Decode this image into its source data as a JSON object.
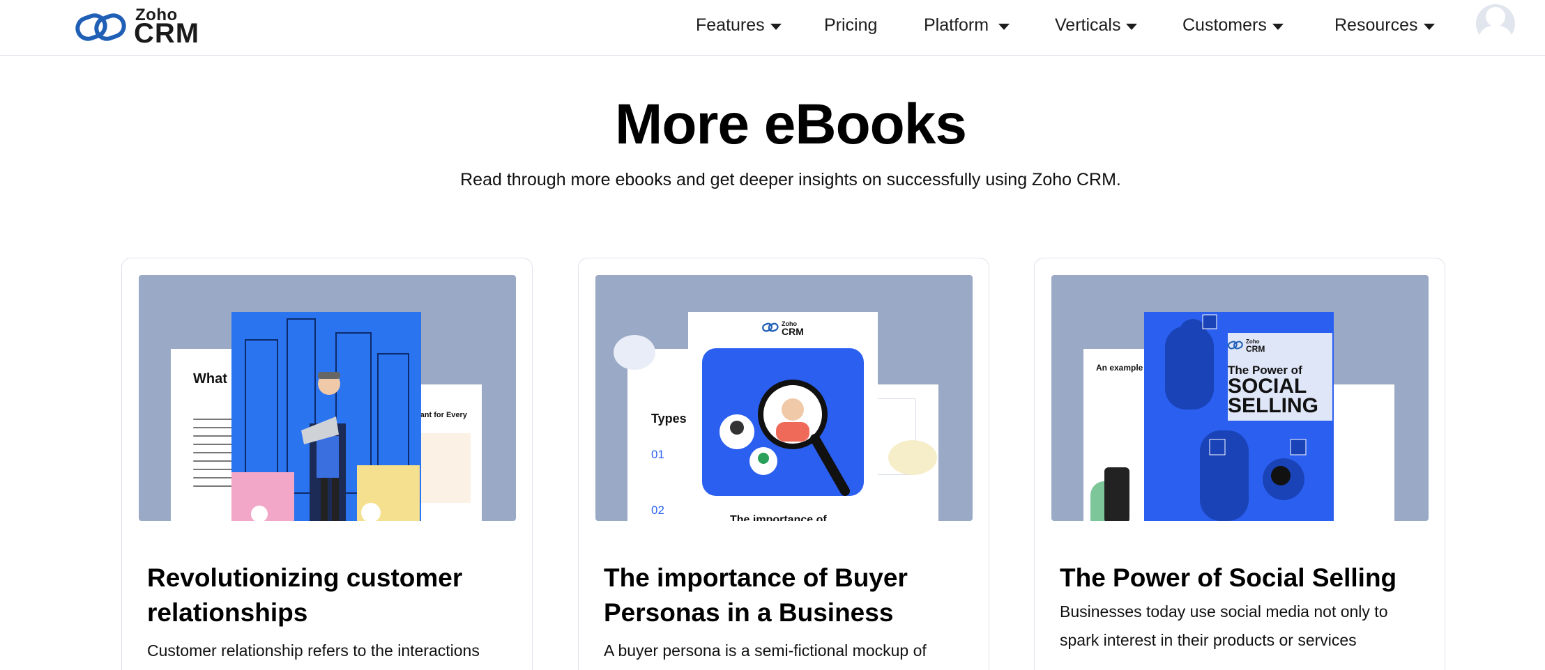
{
  "header": {
    "logo": {
      "top_text": "Zoho",
      "bottom_text": "CRM"
    },
    "nav": [
      {
        "label": "Features",
        "dropdown": true
      },
      {
        "label": "Pricing",
        "dropdown": false
      },
      {
        "label": "Platform",
        "dropdown": true
      },
      {
        "label": "Verticals",
        "dropdown": true
      },
      {
        "label": "Customers",
        "dropdown": true
      },
      {
        "label": "Resources",
        "dropdown": true
      }
    ]
  },
  "main": {
    "title": "More eBooks",
    "subtitle": "Read through more ebooks and get deeper insights on successfully using Zoho CRM."
  },
  "cards": [
    {
      "title": "Revolutionizing customer relationships",
      "description": "Customer relationship refers to the interactions",
      "cover": {
        "back_left_text": "What custo",
        "back_right_text": "tant for Every"
      }
    },
    {
      "title": "The importance of Buyer Personas in a Business",
      "description": "A buyer persona is a semi-fictional mockup of",
      "cover": {
        "logo_top": "Zoho",
        "logo_bottom": "CRM",
        "back_left_text": "Types c",
        "list_1": "01",
        "list_2": "02",
        "bottom_text": "The importance of"
      }
    },
    {
      "title": "The Power of Social Selling",
      "description": "Businesses today use social media not only to spark interest in their products or services",
      "cover": {
        "logo_top": "Zoho",
        "logo_bottom": "CRM",
        "headline_1": "The Power of",
        "headline_2": "SOCIAL",
        "headline_3": "SELLING",
        "back_left_text": "An example"
      }
    }
  ],
  "colors": {
    "thumb_bg": "#9aaac6",
    "cover_blue": "#2b63f0",
    "logo_blue": "#1f5fb6"
  }
}
